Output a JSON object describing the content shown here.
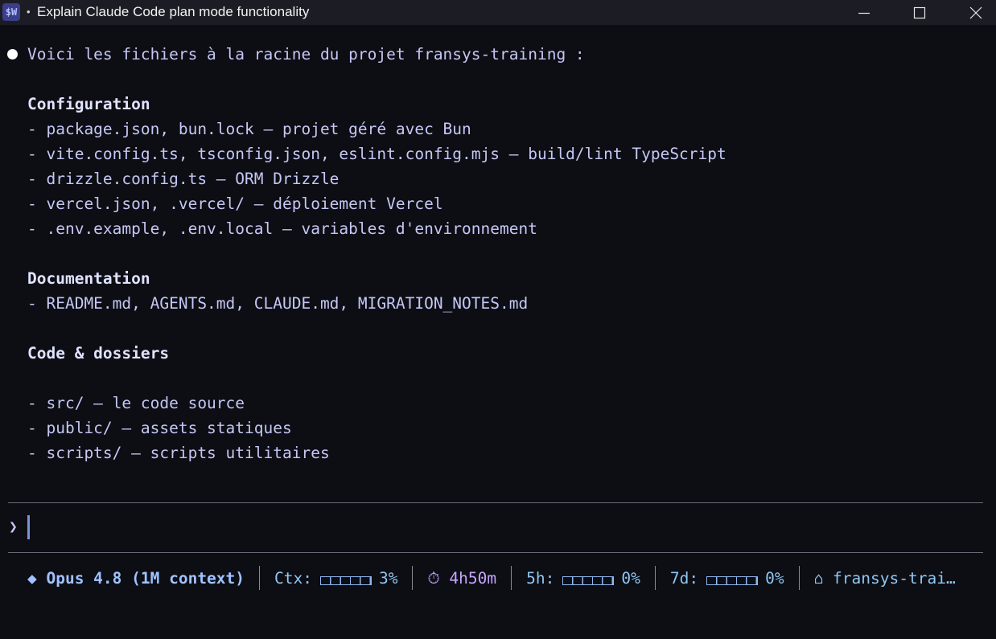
{
  "window": {
    "app_icon_text": "$W",
    "title_dot": "•",
    "title": "Explain Claude Code plan mode functionality"
  },
  "message": {
    "intro": "Voici les fichiers à la racine du projet fransys-training :",
    "sections": [
      {
        "heading": "Configuration",
        "items": [
          "- package.json, bun.lock — projet géré avec Bun",
          "- vite.config.ts, tsconfig.json, eslint.config.mjs — build/lint TypeScript",
          "- drizzle.config.ts — ORM Drizzle",
          "- vercel.json, .vercel/ — déploiement Vercel",
          "- .env.example, .env.local — variables d'environnement"
        ]
      },
      {
        "heading": "Documentation",
        "items": [
          "- README.md, AGENTS.md, CLAUDE.md, MIGRATION_NOTES.md"
        ]
      },
      {
        "heading": "Code & dossiers",
        "items": [
          "- src/ — le code source",
          "- public/ — assets statiques",
          "- scripts/ — scripts utilitaires"
        ]
      }
    ]
  },
  "prompt": {
    "symbol": "❯",
    "value": ""
  },
  "status": {
    "model": "◆ Opus 4.8 (1M context)",
    "ctx_label": "Ctx:",
    "ctx_pct": "3%",
    "ctx_fraction": 0.03,
    "timer": "⏱ 4h50m",
    "five_h_label": "5h:",
    "five_h_pct": "0%",
    "seven_d_label": "7d:",
    "seven_d_pct": "0%",
    "project": "⌂ fransys-trai…"
  },
  "colors": {
    "background": "#0d0d14",
    "titlebar": "#1c1c24",
    "text": "#c4c8f4",
    "status_accent": "#9fc3ff",
    "timer": "#c6a6ff"
  }
}
